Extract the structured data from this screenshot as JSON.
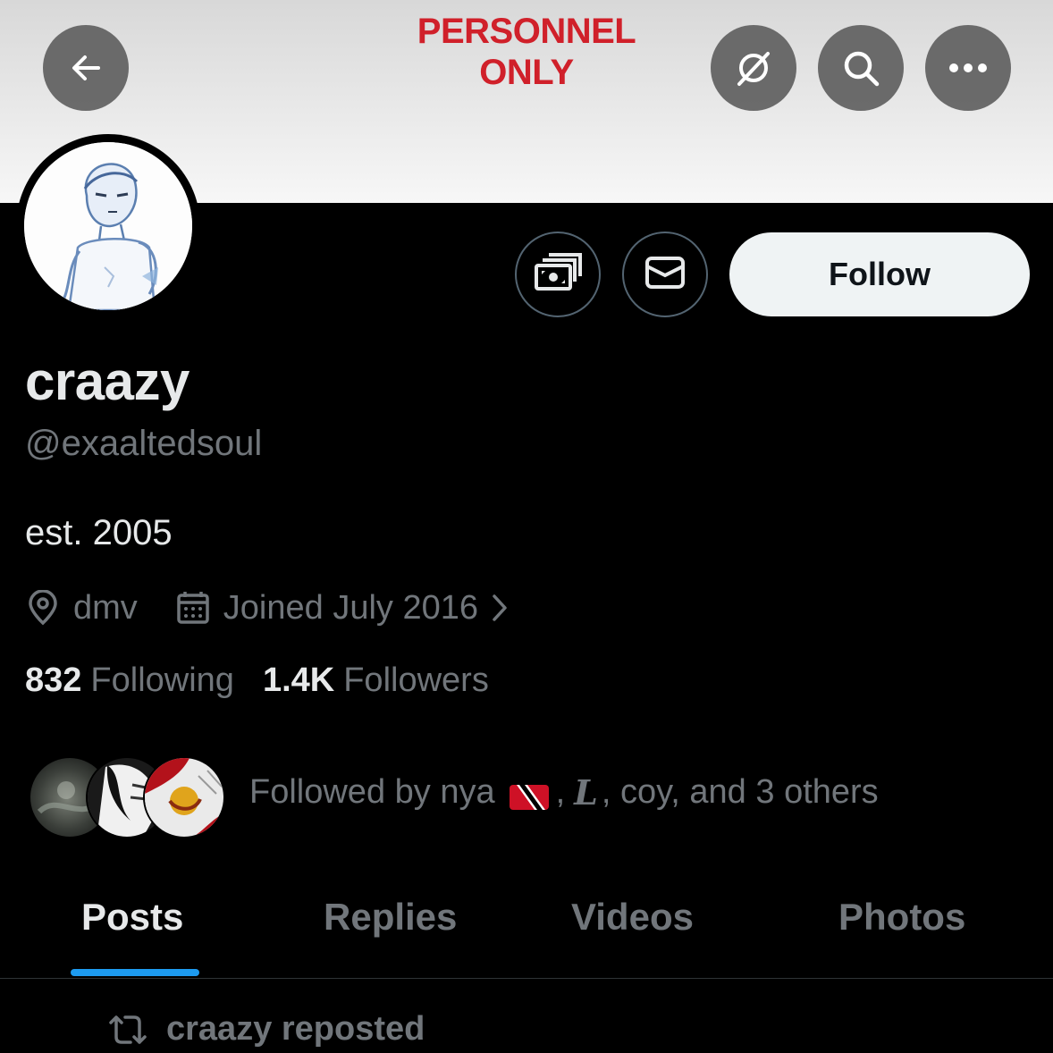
{
  "banner": {
    "text_line1": "PERSONNEL",
    "text_line2": "ONLY"
  },
  "header_icons": {
    "back": "arrow-left-icon",
    "grok": "grok-icon",
    "search": "search-icon",
    "more": "more-icon"
  },
  "actions": {
    "tip_icon": "money-icon",
    "message_icon": "mail-icon",
    "follow_label": "Follow"
  },
  "profile": {
    "display_name": "craazy",
    "handle": "@exaaltedsoul",
    "bio": "est. 2005",
    "location": "dmv",
    "joined": "Joined July 2016"
  },
  "stats": {
    "following_count": "832",
    "following_label": "Following",
    "followers_count": "1.4K",
    "followers_label": "Followers"
  },
  "followed_by": {
    "prefix": "Followed by nya",
    "comma": ",",
    "second_name": "L",
    "suffix": ", coy, and 3 others"
  },
  "tabs": [
    {
      "label": "Posts",
      "active": true
    },
    {
      "label": "Replies",
      "active": false
    },
    {
      "label": "Videos",
      "active": false
    },
    {
      "label": "Photos",
      "active": false
    }
  ],
  "feed": {
    "repost_label": "craazy reposted"
  },
  "colors": {
    "background": "#000000",
    "accent": "#1d9bf0",
    "banner_text": "#d0202a",
    "secondary_text": "#71767b",
    "primary_text": "#e7e9ea"
  }
}
